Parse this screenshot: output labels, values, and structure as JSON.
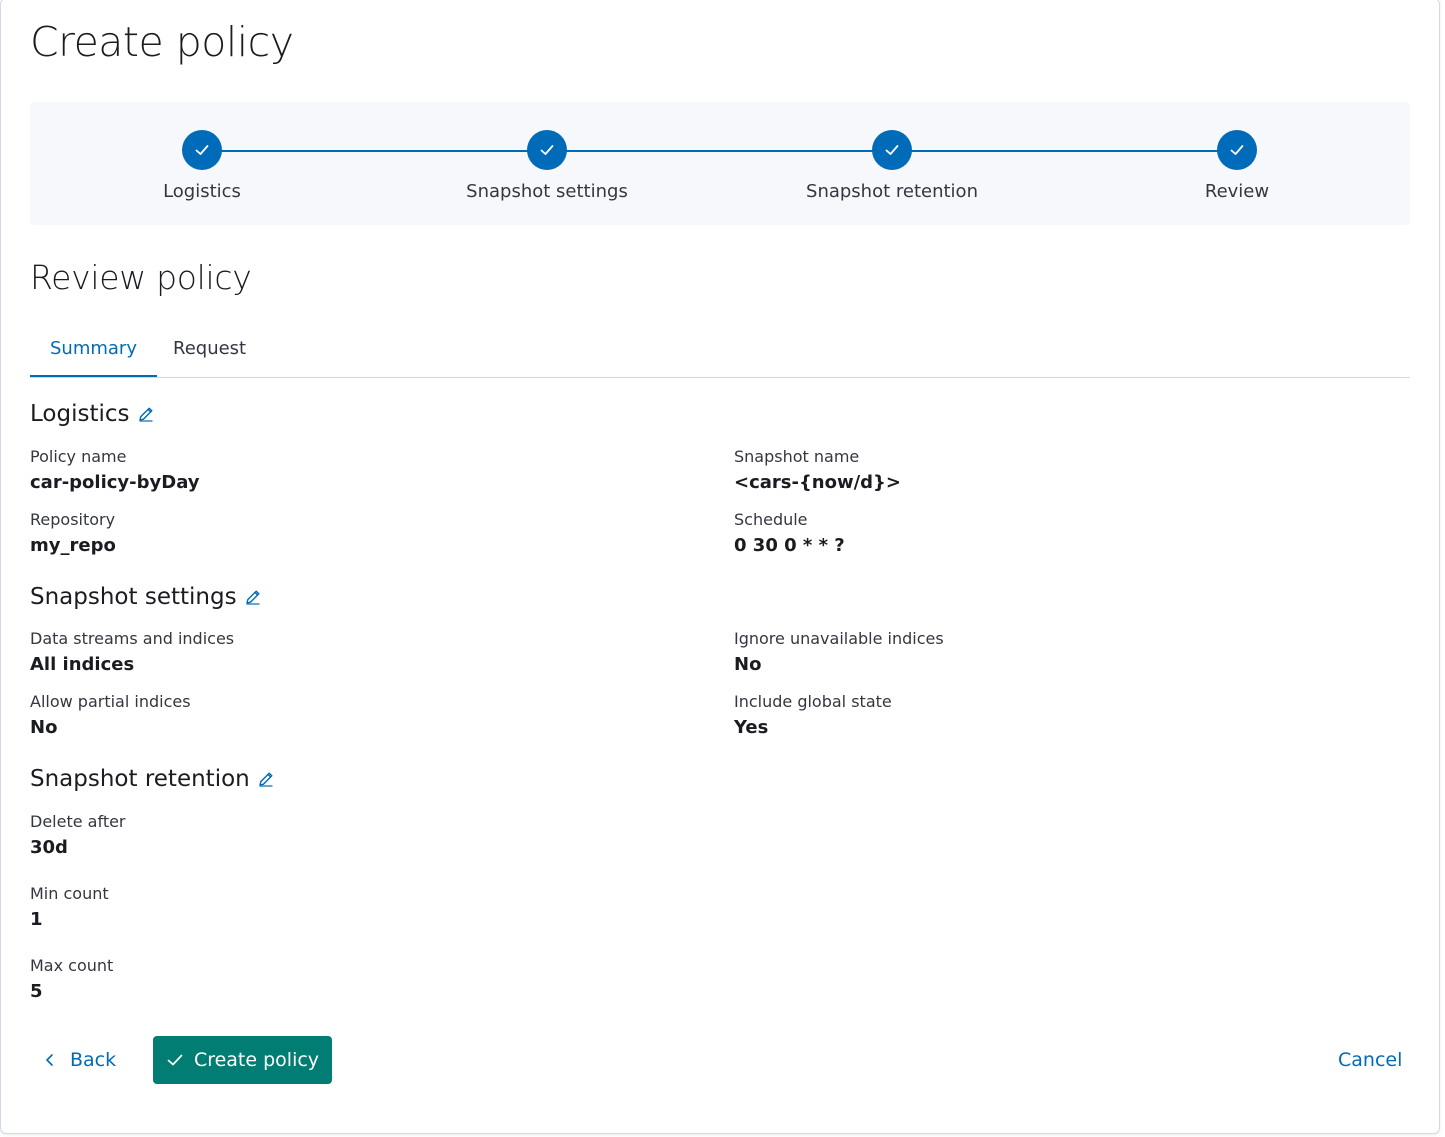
{
  "page": {
    "title": "Create policy"
  },
  "colors": {
    "accent": "#006bb8",
    "success": "#017d73",
    "steps_background": "#f7f8fc"
  },
  "steps": [
    {
      "label": "Logistics",
      "status": "complete",
      "icon": "check-icon"
    },
    {
      "label": "Snapshot settings",
      "status": "complete",
      "icon": "check-icon"
    },
    {
      "label": "Snapshot retention",
      "status": "complete",
      "icon": "check-icon"
    },
    {
      "label": "Review",
      "status": "complete",
      "icon": "check-icon"
    }
  ],
  "review": {
    "title": "Review policy",
    "tabs": [
      {
        "label": "Summary",
        "selected": true
      },
      {
        "label": "Request",
        "selected": false
      }
    ]
  },
  "logistics": {
    "title": "Logistics",
    "policy_name_label": "Policy name",
    "policy_name": "car-policy-byDay",
    "repository_label": "Repository",
    "repository": "my_repo",
    "snapshot_name_label": "Snapshot name",
    "snapshot_name": "<cars-{now/d}>",
    "schedule_label": "Schedule",
    "schedule": "0 30 0 * * ?"
  },
  "snapshot_settings": {
    "title": "Snapshot settings",
    "indices_label": "Data streams and indices",
    "indices": "All indices",
    "partial_label": "Allow partial indices",
    "partial": "No",
    "ignore_unavailable_label": "Ignore unavailable indices",
    "ignore_unavailable": "No",
    "global_state_label": "Include global state",
    "global_state": "Yes"
  },
  "retention": {
    "title": "Snapshot retention",
    "delete_after_label": "Delete after",
    "delete_after": "30d",
    "min_count_label": "Min count",
    "min_count": "1",
    "max_count_label": "Max count",
    "max_count": "5"
  },
  "footer": {
    "back_label": "Back",
    "create_label": "Create policy",
    "cancel_label": "Cancel"
  }
}
